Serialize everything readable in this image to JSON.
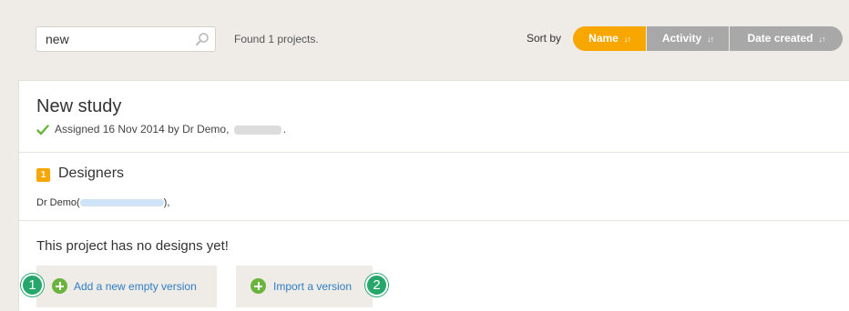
{
  "search": {
    "value": "new",
    "placeholder": ""
  },
  "results": {
    "found_text": "Found 1 projects."
  },
  "sort": {
    "label": "Sort by",
    "options": [
      {
        "label": "Name",
        "active": true
      },
      {
        "label": "Activity",
        "active": false
      },
      {
        "label": "Date created",
        "active": false
      }
    ],
    "arrows_icon": "sort-arrows-icon"
  },
  "project": {
    "title": "New study",
    "assigned_prefix": "Assigned 16 Nov 2014 by Dr Demo,",
    "assigned_suffix": ".",
    "designers": {
      "count": "1",
      "title": "Designers",
      "entry_prefix": "Dr Demo(",
      "entry_suffix": "),"
    },
    "empty_message": "This project has no designs yet!",
    "actions": {
      "add_empty": "Add a new empty version",
      "import": "Import a version"
    }
  },
  "markers": {
    "first": "1",
    "second": "2"
  },
  "colors": {
    "accent": "#f7a700",
    "inactive_sort": "#a8a8a8",
    "link": "#2d7ec4",
    "success": "#6ab43e",
    "marker": "#27a66b"
  }
}
